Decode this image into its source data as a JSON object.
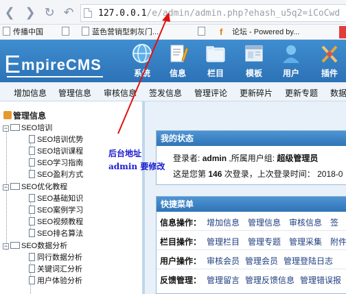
{
  "browser": {
    "url_host": "127.0.0.1",
    "url_path": "/e/admin/admin.php?ehash_u5q2=iCoCwd",
    "bookmarks": [
      "传播中国",
      "",
      "蓝色营销型刺灰门...",
      "",
      "论坛 - Powered by..."
    ]
  },
  "app": {
    "logo": "EmpireCMS",
    "logo_initial": "E",
    "logo_rest": "mpireCMS",
    "top_menu": [
      {
        "label": "系统",
        "icon": "globe-icon"
      },
      {
        "label": "信息",
        "icon": "document-pencil-icon"
      },
      {
        "label": "栏目",
        "icon": "folder-icon"
      },
      {
        "label": "模板",
        "icon": "template-icon"
      },
      {
        "label": "用户",
        "icon": "user-icon"
      },
      {
        "label": "插件",
        "icon": "plugin-icon"
      }
    ],
    "sub_menu": [
      "增加信息",
      "管理信息",
      "审核信息",
      "签发信息",
      "管理评论",
      "更新碎片",
      "更新专题",
      "数据"
    ]
  },
  "tree": {
    "title": "管理信息",
    "groups": [
      {
        "label": "SEO培训",
        "items": [
          "SEO培训优势",
          "SEO培训课程",
          "SEO学习指南",
          "SEO盈利方式"
        ]
      },
      {
        "label": "SEO优化教程",
        "items": [
          "SEO基础知识",
          "SEO案例学习",
          "SEO视频教程",
          "SEO排名算法"
        ]
      },
      {
        "label": "SEO数据分析",
        "items": [
          "同行数据分析",
          "关键词汇分析",
          "用户体验分析"
        ]
      }
    ]
  },
  "status_box": {
    "title": "我的状态",
    "login_label": "登录者:",
    "user": "admin",
    "group_label": ",所属用户组:",
    "group": "超级管理员",
    "count_prefix": "这是您第",
    "count": "146",
    "count_suffix": "次登录，上次登录时间：",
    "last_time": "2018-0"
  },
  "quick_menu": {
    "title": "快捷菜单",
    "rows": [
      {
        "label": "信息操作：",
        "links": [
          "增加信息",
          "管理信息",
          "审核信息",
          "签"
        ]
      },
      {
        "label": "栏目操作：",
        "links": [
          "管理栏目",
          "管理专题",
          "管理采集",
          "附件"
        ]
      },
      {
        "label": "用户操作：",
        "links": [
          "审核会员",
          "管理会员",
          "管理登陆日志"
        ]
      },
      {
        "label": "反馈管理：",
        "links": [
          "管理留言",
          "管理反馈信息",
          "管理错误报"
        ]
      }
    ]
  },
  "annotation": {
    "line1": "后台地址",
    "line2": "admin 要修改",
    "color": "#1a1ad0",
    "arrow_color": "#e01010"
  }
}
